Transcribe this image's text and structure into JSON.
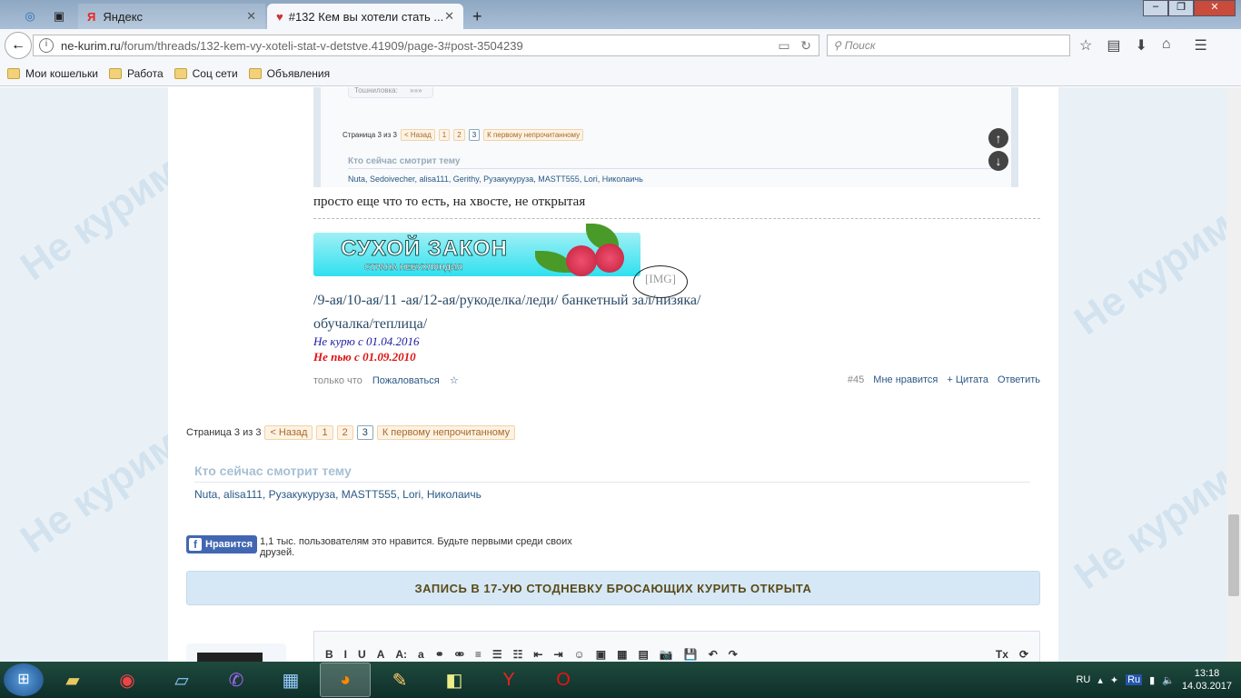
{
  "browser": {
    "tabs": [
      {
        "label": "Яндекс",
        "icon": "yandex-icon"
      },
      {
        "label": "#132 Кем вы хотели стать ...",
        "icon": "site-favicon",
        "active": true
      }
    ],
    "url_domain": "ne-kurim.ru",
    "url_path": "/forum/threads/132-kem-vy-xoteli-stat-v-detstve.41909/page-3#post-3504239",
    "search_placeholder": "Поиск",
    "bookmarks": [
      "Мои кошельки",
      "Работа",
      "Соц сети",
      "Объявления"
    ]
  },
  "embedded": {
    "stat_label": "Тошниловка:",
    "stat_value": "»»»",
    "pager": {
      "label": "Страница 3 из 3",
      "back": "< Назад",
      "pages": [
        "1",
        "2",
        "3"
      ],
      "unread": "К первому непрочитанному"
    },
    "watch_title": "Кто сейчас смотрит тему",
    "users": "Nuta, Sedoivecher, alisa111, Gerithy, Рузакукуруза, MASTT555, Lori, Николаичь"
  },
  "post": {
    "text": "просто еще что то есть, на хвосте, не открытая",
    "banner_title": "СУХОЙ ЗАКОН",
    "banner_sub": "СТРАНА НЕБУХЛЯНДИЯ",
    "img_placeholder": "[IMG]",
    "sig_line1": "/9-ая/10-ая/11 -ая/12-ая/рукоделка/леди/ банкетный зал/низяка/",
    "sig_line2": "обучалка/теплица/",
    "sig_line3": "Не курю с 01.04.2016",
    "sig_line4": "Не пью с 01.09.2010",
    "time": "только что",
    "report": "Пожаловаться",
    "star": "☆",
    "number": "#45",
    "like": "Мне нравится",
    "quote": "+ Цитата",
    "reply": "Ответить"
  },
  "pager": {
    "label": "Страница 3 из 3",
    "back": "< Назад",
    "pages": [
      "1",
      "2",
      "3"
    ],
    "unread": "К первому непрочитанному"
  },
  "watching": {
    "title": "Кто сейчас смотрит тему",
    "users": "Nuta, alisa111, Рузакукуруза, MASTT555, Lori, Николаичь"
  },
  "facebook": {
    "button": "Нравится",
    "text": "1,1 тыс. пользователям это нравится. Будьте первыми среди своих друзей."
  },
  "notice": "ЗАПИСЬ В 17-УЮ СТОДНЕВКУ БРОСАЮЩИХ КУРИТЬ ОТКРЫТА",
  "editor": {
    "buttons": [
      "B",
      "I",
      "U",
      "A",
      "A:",
      "a",
      "⚭",
      "⚮",
      "≡",
      "☰",
      "☷",
      "⇤",
      "⇥",
      "☺",
      "▣",
      "▦",
      "▤",
      "📷",
      "💾",
      "↶",
      "↷",
      "Tx",
      "⟳"
    ]
  },
  "taskbar": {
    "lang": "RU",
    "time": "13:18",
    "date": "14.03.2017",
    "tray_ru": "Ru"
  }
}
